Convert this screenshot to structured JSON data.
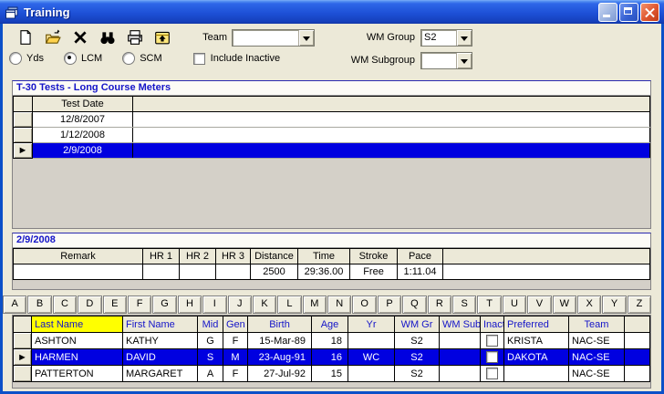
{
  "window": {
    "title": "Training"
  },
  "titlebar": {
    "icons": [
      "app-form-icon",
      "minimize-icon",
      "maximize-icon",
      "close-icon"
    ]
  },
  "colors": {
    "selection_blue": "#0000E0",
    "sort_column_highlight": "#FFFF00",
    "titlebar_blue": "#1D50D6",
    "header_text_blue": "#1414C8"
  },
  "toolbar": {
    "icons": [
      "new-document-icon",
      "open-folder-icon",
      "delete-icon",
      "find-binoculars-icon",
      "print-icon",
      "folder-up-icon"
    ],
    "team_label": "Team",
    "team_value": "",
    "wm_group_label": "WM Group",
    "wm_group_value": "S2",
    "wm_subgroup_label": "WM Subgroup",
    "wm_subgroup_value": ""
  },
  "filters": {
    "radios": [
      {
        "label": "Yds",
        "selected": false
      },
      {
        "label": "LCM",
        "selected": true
      },
      {
        "label": "SCM",
        "selected": false
      }
    ],
    "include_inactive_label": "Include Inactive",
    "include_inactive_checked": false
  },
  "tests_panel": {
    "title": "T-30 Tests - Long Course Meters",
    "columns": [
      "Test Date"
    ],
    "rows": [
      {
        "date": "12/8/2007",
        "selected": false
      },
      {
        "date": "1/12/2008",
        "selected": false
      },
      {
        "date": "2/9/2008",
        "selected": true
      }
    ]
  },
  "detail_panel": {
    "title": "2/9/2008",
    "columns": [
      "Remark",
      "HR 1",
      "HR 2",
      "HR 3",
      "Distance",
      "Time",
      "Stroke",
      "Pace"
    ],
    "rows": [
      [
        "",
        "",
        "",
        "",
        "2500",
        "29:36.00",
        "Free",
        "1:11.04"
      ]
    ]
  },
  "alphabet_bar": {
    "letters": [
      "A",
      "B",
      "C",
      "D",
      "E",
      "F",
      "G",
      "H",
      "I",
      "J",
      "K",
      "L",
      "M",
      "N",
      "O",
      "P",
      "Q",
      "R",
      "S",
      "T",
      "U",
      "V",
      "W",
      "X",
      "Y",
      "Z"
    ]
  },
  "swimmers_table": {
    "columns": [
      "Last Name",
      "First Name",
      "Mid",
      "Gen",
      "Birth",
      "Age",
      "Yr",
      "WM Gr",
      "WM Sub",
      "Inact",
      "Preferred",
      "Team"
    ],
    "sorted_column": "Last Name",
    "rows": [
      {
        "last": "ASHTON",
        "first": "KATHY",
        "mid": "G",
        "gen": "F",
        "birth": "15-Mar-89",
        "age": "18",
        "yr": "",
        "wm_gr": "S2",
        "wm_sub": "",
        "inactive": false,
        "preferred": "KRISTA",
        "team": "NAC-SE",
        "selected": false
      },
      {
        "last": "HARMEN",
        "first": "DAVID",
        "mid": "S",
        "gen": "M",
        "birth": "23-Aug-91",
        "age": "16",
        "yr": "WC",
        "wm_gr": "S2",
        "wm_sub": "",
        "inactive": false,
        "preferred": "DAKOTA",
        "team": "NAC-SE",
        "selected": true
      },
      {
        "last": "PATTERTON",
        "first": "MARGARET",
        "mid": "A",
        "gen": "F",
        "birth": "27-Jul-92",
        "age": "15",
        "yr": "",
        "wm_gr": "S2",
        "wm_sub": "",
        "inactive": false,
        "preferred": "",
        "team": "NAC-SE",
        "selected": false
      }
    ]
  }
}
